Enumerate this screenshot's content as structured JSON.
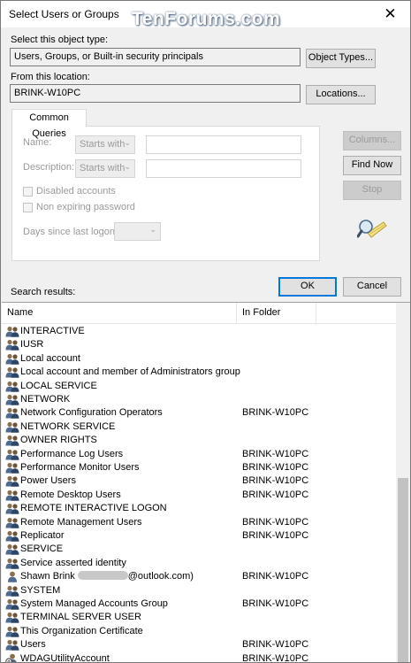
{
  "window": {
    "title": "Select Users or Groups",
    "watermark": "TenForums.com",
    "close_glyph": "✕"
  },
  "object_type": {
    "label": "Select this object type:",
    "value": "Users, Groups, or Built-in security principals",
    "button": "Object Types..."
  },
  "location": {
    "label": "From this location:",
    "value": "BRINK-W10PC",
    "button": "Locations..."
  },
  "common_queries": {
    "tab_label": "Common Queries",
    "name_label": "Name:",
    "name_mode": "Starts with",
    "description_label": "Description:",
    "description_mode": "Starts with",
    "disabled_accounts": "Disabled accounts",
    "non_expiring_password": "Non expiring password",
    "days_since_logon": "Days since last logon:"
  },
  "side_buttons": {
    "columns": "Columns...",
    "find_now": "Find Now",
    "stop": "Stop"
  },
  "dialog_buttons": {
    "ok": "OK",
    "cancel": "Cancel"
  },
  "search_results": {
    "label": "Search results:",
    "columns": [
      "Name",
      "In Folder"
    ],
    "rows": [
      {
        "name": "INTERACTIVE",
        "folder": "",
        "icon": "group-icon"
      },
      {
        "name": "IUSR",
        "folder": "",
        "icon": "group-icon"
      },
      {
        "name": "Local account",
        "folder": "",
        "icon": "group-icon"
      },
      {
        "name": "Local account and member of Administrators group",
        "folder": "",
        "icon": "group-icon"
      },
      {
        "name": "LOCAL SERVICE",
        "folder": "",
        "icon": "group-icon"
      },
      {
        "name": "NETWORK",
        "folder": "",
        "icon": "group-icon"
      },
      {
        "name": "Network Configuration Operators",
        "folder": "BRINK-W10PC",
        "icon": "group-icon"
      },
      {
        "name": "NETWORK SERVICE",
        "folder": "",
        "icon": "group-icon"
      },
      {
        "name": "OWNER RIGHTS",
        "folder": "",
        "icon": "group-icon"
      },
      {
        "name": "Performance Log Users",
        "folder": "BRINK-W10PC",
        "icon": "group-icon"
      },
      {
        "name": "Performance Monitor Users",
        "folder": "BRINK-W10PC",
        "icon": "group-icon"
      },
      {
        "name": "Power Users",
        "folder": "BRINK-W10PC",
        "icon": "group-icon"
      },
      {
        "name": "Remote Desktop Users",
        "folder": "BRINK-W10PC",
        "icon": "group-icon"
      },
      {
        "name": "REMOTE INTERACTIVE LOGON",
        "folder": "",
        "icon": "group-icon"
      },
      {
        "name": "Remote Management Users",
        "folder": "BRINK-W10PC",
        "icon": "group-icon"
      },
      {
        "name": "Replicator",
        "folder": "BRINK-W10PC",
        "icon": "group-icon"
      },
      {
        "name": "SERVICE",
        "folder": "",
        "icon": "group-icon"
      },
      {
        "name": "Service asserted identity",
        "folder": "",
        "icon": "group-icon"
      },
      {
        "name": "Shawn Brink",
        "name_suffix": "@outlook.com)",
        "folder": "BRINK-W10PC",
        "icon": "user-icon"
      },
      {
        "name": "SYSTEM",
        "folder": "",
        "icon": "group-icon"
      },
      {
        "name": "System Managed Accounts Group",
        "folder": "BRINK-W10PC",
        "icon": "group-icon"
      },
      {
        "name": "TERMINAL SERVER USER",
        "folder": "",
        "icon": "group-icon"
      },
      {
        "name": "This Organization Certificate",
        "folder": "",
        "icon": "group-icon"
      },
      {
        "name": "Users",
        "folder": "BRINK-W10PC",
        "icon": "group-icon"
      },
      {
        "name": "WDAGUtilityAccount",
        "folder": "BRINK-W10PC",
        "icon": "disabled-user-icon"
      }
    ]
  },
  "colors": {
    "accent": "#0078d7",
    "dialog_bg": "#f0f0f0",
    "disabled_text": "#9a9a9a"
  }
}
